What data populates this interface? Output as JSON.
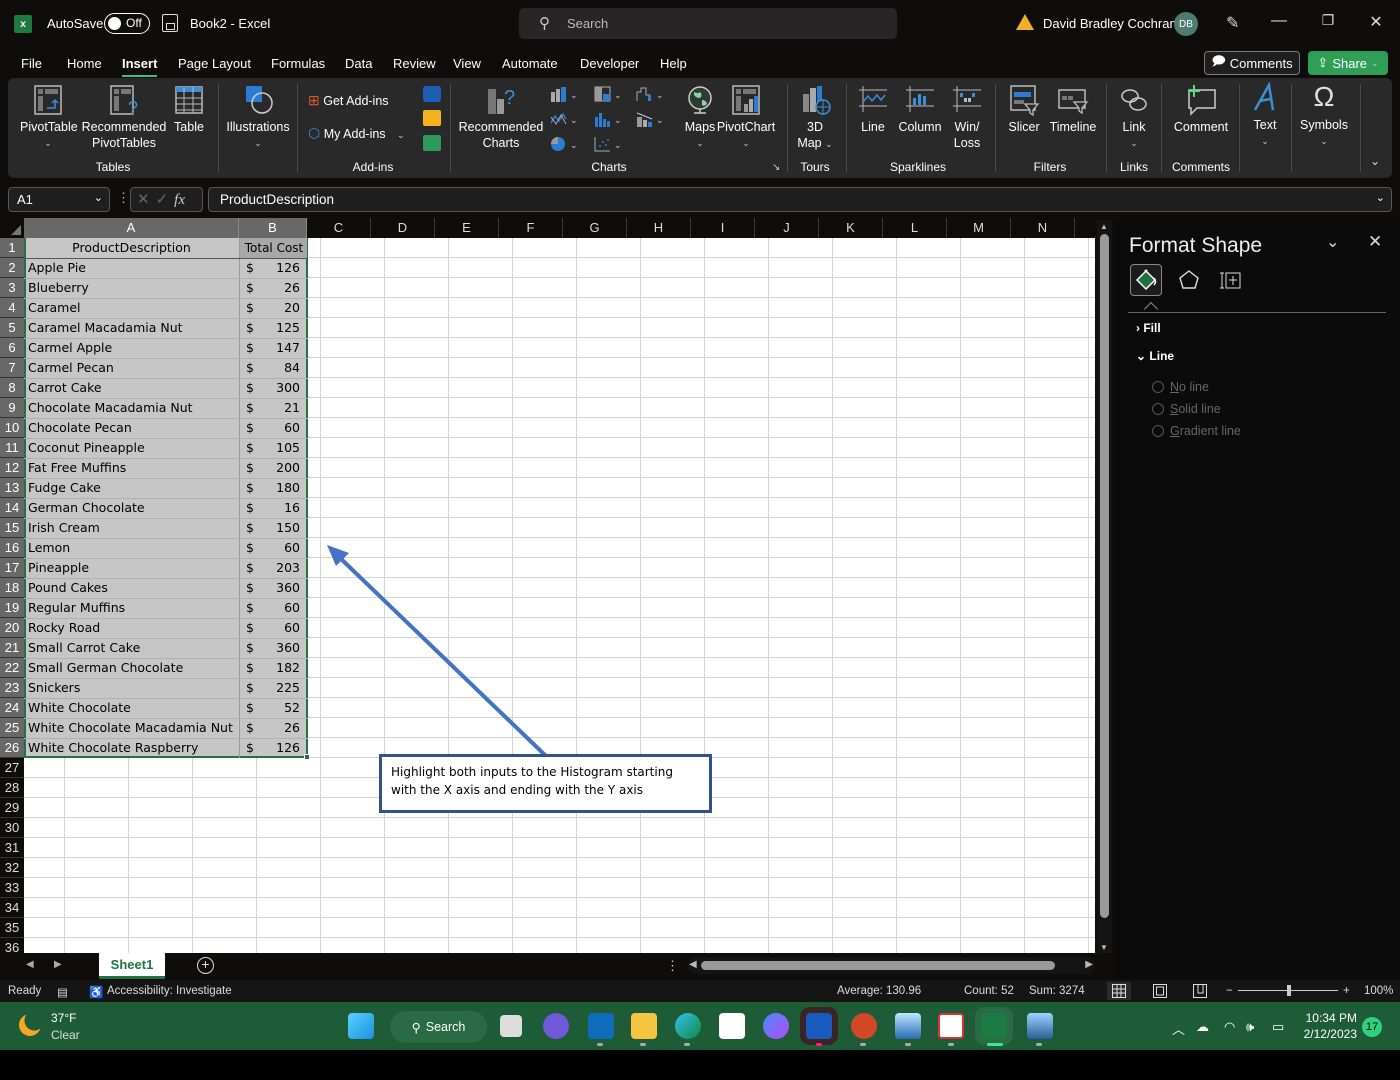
{
  "titlebar": {
    "autosave_label": "AutoSave",
    "autosave_state": "Off",
    "document_title": "Book2  -  Excel",
    "search_placeholder": "Search",
    "user_name": "David Bradley Cochran",
    "user_initials": "DB"
  },
  "menu": {
    "tabs": [
      "File",
      "Home",
      "Insert",
      "Page Layout",
      "Formulas",
      "Data",
      "Review",
      "View",
      "Automate",
      "Developer",
      "Help"
    ],
    "active_tab": "Insert",
    "comments_label": "Comments",
    "share_label": "Share"
  },
  "ribbon": {
    "buttons": {
      "pivottable": "PivotTable",
      "recommended_pivottables_1": "Recommended",
      "recommended_pivottables_2": "PivotTables",
      "table": "Table",
      "illustrations": "Illustrations",
      "get_addins": "Get Add-ins",
      "my_addins": "My Add-ins",
      "recommended_charts_1": "Recommended",
      "recommended_charts_2": "Charts",
      "maps": "Maps",
      "pivotchart": "PivotChart",
      "map3d_1": "3D",
      "map3d_2": "Map",
      "line": "Line",
      "column": "Column",
      "winloss_1": "Win/",
      "winloss_2": "Loss",
      "slicer": "Slicer",
      "timeline": "Timeline",
      "link": "Link",
      "comment": "Comment",
      "text": "Text",
      "symbols": "Symbols"
    },
    "groups": {
      "tables": "Tables",
      "addins": "Add-ins",
      "charts": "Charts",
      "tours": "Tours",
      "sparklines": "Sparklines",
      "filters": "Filters",
      "links": "Links",
      "comments": "Comments"
    }
  },
  "formula_bar": {
    "name_box": "A1",
    "formula": "ProductDescription"
  },
  "sheet": {
    "columns": [
      "A",
      "B",
      "C",
      "D",
      "E",
      "F",
      "G",
      "H",
      "I",
      "J",
      "K",
      "L",
      "M",
      "N"
    ],
    "rows_visible": [
      "1",
      "2",
      "3",
      "4",
      "5",
      "6",
      "7",
      "8",
      "9",
      "10",
      "11",
      "12",
      "13",
      "14",
      "15",
      "16",
      "17",
      "18",
      "19",
      "20",
      "21",
      "22",
      "23",
      "24",
      "25",
      "26",
      "27",
      "28",
      "29",
      "30",
      "31",
      "32",
      "33",
      "34",
      "35",
      "36"
    ],
    "header": {
      "a": "ProductDescription",
      "b": "Total Cost"
    },
    "currency_symbol": "$",
    "data": [
      {
        "product": "Apple Pie",
        "cost": "126"
      },
      {
        "product": "Blueberry",
        "cost": "26"
      },
      {
        "product": "Caramel",
        "cost": "20"
      },
      {
        "product": "Caramel Macadamia Nut",
        "cost": "125"
      },
      {
        "product": "Carmel Apple",
        "cost": "147"
      },
      {
        "product": "Carmel Pecan",
        "cost": "84"
      },
      {
        "product": "Carrot Cake",
        "cost": "300"
      },
      {
        "product": "Chocolate Macadamia Nut",
        "cost": "21"
      },
      {
        "product": "Chocolate Pecan",
        "cost": "60"
      },
      {
        "product": "Coconut Pineapple",
        "cost": "105"
      },
      {
        "product": "Fat Free Muffins",
        "cost": "200"
      },
      {
        "product": "Fudge Cake",
        "cost": "180"
      },
      {
        "product": "German Chocolate",
        "cost": "16"
      },
      {
        "product": "Irish Cream",
        "cost": "150"
      },
      {
        "product": "Lemon",
        "cost": "60"
      },
      {
        "product": "Pineapple",
        "cost": "203"
      },
      {
        "product": "Pound Cakes",
        "cost": "360"
      },
      {
        "product": "Regular Muffins",
        "cost": "60"
      },
      {
        "product": "Rocky Road",
        "cost": "60"
      },
      {
        "product": "Small Carrot Cake",
        "cost": "360"
      },
      {
        "product": "Small German Chocolate",
        "cost": "182"
      },
      {
        "product": "Snickers",
        "cost": "225"
      },
      {
        "product": "White Chocolate",
        "cost": "52"
      },
      {
        "product": "White Chocolate Macadamia Nut",
        "cost": "26"
      },
      {
        "product": "White Chocolate Raspberry",
        "cost": "126"
      }
    ],
    "selected_range": "A1:B26",
    "callout_text": "Highlight both inputs to the Histogram starting with the X axis and ending with the Y axis",
    "callout_border_color": "#2f528f",
    "selection_color": "#217346"
  },
  "format_pane": {
    "title": "Format Shape",
    "sections": {
      "fill": "Fill",
      "line": "Line"
    },
    "line_options": [
      {
        "accel": "N",
        "rest": "o line"
      },
      {
        "accel": "S",
        "rest": "olid line"
      },
      {
        "accel": "G",
        "rest": "radient line"
      }
    ]
  },
  "sheet_tabs": {
    "active": "Sheet1"
  },
  "statusbar": {
    "mode": "Ready",
    "accessibility": "Accessibility: Investigate",
    "average": "Average: 130.96",
    "count": "Count: 52",
    "sum": "Sum: 3274",
    "zoom": "100%",
    "zoom_percent": 100
  },
  "taskbar": {
    "temperature": "37°F",
    "weather": "Clear",
    "search_label": "Search",
    "time": "10:34 PM",
    "date": "2/12/2023",
    "notifications": "17"
  }
}
